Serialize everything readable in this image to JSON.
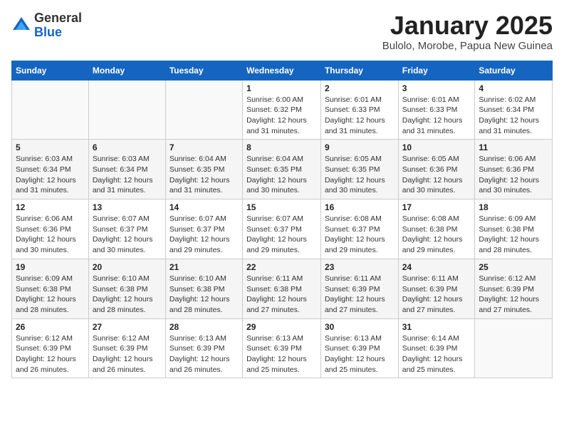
{
  "logo": {
    "general": "General",
    "blue": "Blue"
  },
  "title": "January 2025",
  "location": "Bulolo, Morobe, Papua New Guinea",
  "days_of_week": [
    "Sunday",
    "Monday",
    "Tuesday",
    "Wednesday",
    "Thursday",
    "Friday",
    "Saturday"
  ],
  "weeks": [
    [
      {
        "day": "",
        "info": ""
      },
      {
        "day": "",
        "info": ""
      },
      {
        "day": "",
        "info": ""
      },
      {
        "day": "1",
        "info": "Sunrise: 6:00 AM\nSunset: 6:32 PM\nDaylight: 12 hours and 31 minutes."
      },
      {
        "day": "2",
        "info": "Sunrise: 6:01 AM\nSunset: 6:33 PM\nDaylight: 12 hours and 31 minutes."
      },
      {
        "day": "3",
        "info": "Sunrise: 6:01 AM\nSunset: 6:33 PM\nDaylight: 12 hours and 31 minutes."
      },
      {
        "day": "4",
        "info": "Sunrise: 6:02 AM\nSunset: 6:34 PM\nDaylight: 12 hours and 31 minutes."
      }
    ],
    [
      {
        "day": "5",
        "info": "Sunrise: 6:03 AM\nSunset: 6:34 PM\nDaylight: 12 hours and 31 minutes."
      },
      {
        "day": "6",
        "info": "Sunrise: 6:03 AM\nSunset: 6:34 PM\nDaylight: 12 hours and 31 minutes."
      },
      {
        "day": "7",
        "info": "Sunrise: 6:04 AM\nSunset: 6:35 PM\nDaylight: 12 hours and 31 minutes."
      },
      {
        "day": "8",
        "info": "Sunrise: 6:04 AM\nSunset: 6:35 PM\nDaylight: 12 hours and 30 minutes."
      },
      {
        "day": "9",
        "info": "Sunrise: 6:05 AM\nSunset: 6:35 PM\nDaylight: 12 hours and 30 minutes."
      },
      {
        "day": "10",
        "info": "Sunrise: 6:05 AM\nSunset: 6:36 PM\nDaylight: 12 hours and 30 minutes."
      },
      {
        "day": "11",
        "info": "Sunrise: 6:06 AM\nSunset: 6:36 PM\nDaylight: 12 hours and 30 minutes."
      }
    ],
    [
      {
        "day": "12",
        "info": "Sunrise: 6:06 AM\nSunset: 6:36 PM\nDaylight: 12 hours and 30 minutes."
      },
      {
        "day": "13",
        "info": "Sunrise: 6:07 AM\nSunset: 6:37 PM\nDaylight: 12 hours and 30 minutes."
      },
      {
        "day": "14",
        "info": "Sunrise: 6:07 AM\nSunset: 6:37 PM\nDaylight: 12 hours and 29 minutes."
      },
      {
        "day": "15",
        "info": "Sunrise: 6:07 AM\nSunset: 6:37 PM\nDaylight: 12 hours and 29 minutes."
      },
      {
        "day": "16",
        "info": "Sunrise: 6:08 AM\nSunset: 6:37 PM\nDaylight: 12 hours and 29 minutes."
      },
      {
        "day": "17",
        "info": "Sunrise: 6:08 AM\nSunset: 6:38 PM\nDaylight: 12 hours and 29 minutes."
      },
      {
        "day": "18",
        "info": "Sunrise: 6:09 AM\nSunset: 6:38 PM\nDaylight: 12 hours and 28 minutes."
      }
    ],
    [
      {
        "day": "19",
        "info": "Sunrise: 6:09 AM\nSunset: 6:38 PM\nDaylight: 12 hours and 28 minutes."
      },
      {
        "day": "20",
        "info": "Sunrise: 6:10 AM\nSunset: 6:38 PM\nDaylight: 12 hours and 28 minutes."
      },
      {
        "day": "21",
        "info": "Sunrise: 6:10 AM\nSunset: 6:38 PM\nDaylight: 12 hours and 28 minutes."
      },
      {
        "day": "22",
        "info": "Sunrise: 6:11 AM\nSunset: 6:38 PM\nDaylight: 12 hours and 27 minutes."
      },
      {
        "day": "23",
        "info": "Sunrise: 6:11 AM\nSunset: 6:39 PM\nDaylight: 12 hours and 27 minutes."
      },
      {
        "day": "24",
        "info": "Sunrise: 6:11 AM\nSunset: 6:39 PM\nDaylight: 12 hours and 27 minutes."
      },
      {
        "day": "25",
        "info": "Sunrise: 6:12 AM\nSunset: 6:39 PM\nDaylight: 12 hours and 27 minutes."
      }
    ],
    [
      {
        "day": "26",
        "info": "Sunrise: 6:12 AM\nSunset: 6:39 PM\nDaylight: 12 hours and 26 minutes."
      },
      {
        "day": "27",
        "info": "Sunrise: 6:12 AM\nSunset: 6:39 PM\nDaylight: 12 hours and 26 minutes."
      },
      {
        "day": "28",
        "info": "Sunrise: 6:13 AM\nSunset: 6:39 PM\nDaylight: 12 hours and 26 minutes."
      },
      {
        "day": "29",
        "info": "Sunrise: 6:13 AM\nSunset: 6:39 PM\nDaylight: 12 hours and 25 minutes."
      },
      {
        "day": "30",
        "info": "Sunrise: 6:13 AM\nSunset: 6:39 PM\nDaylight: 12 hours and 25 minutes."
      },
      {
        "day": "31",
        "info": "Sunrise: 6:14 AM\nSunset: 6:39 PM\nDaylight: 12 hours and 25 minutes."
      },
      {
        "day": "",
        "info": ""
      }
    ]
  ]
}
